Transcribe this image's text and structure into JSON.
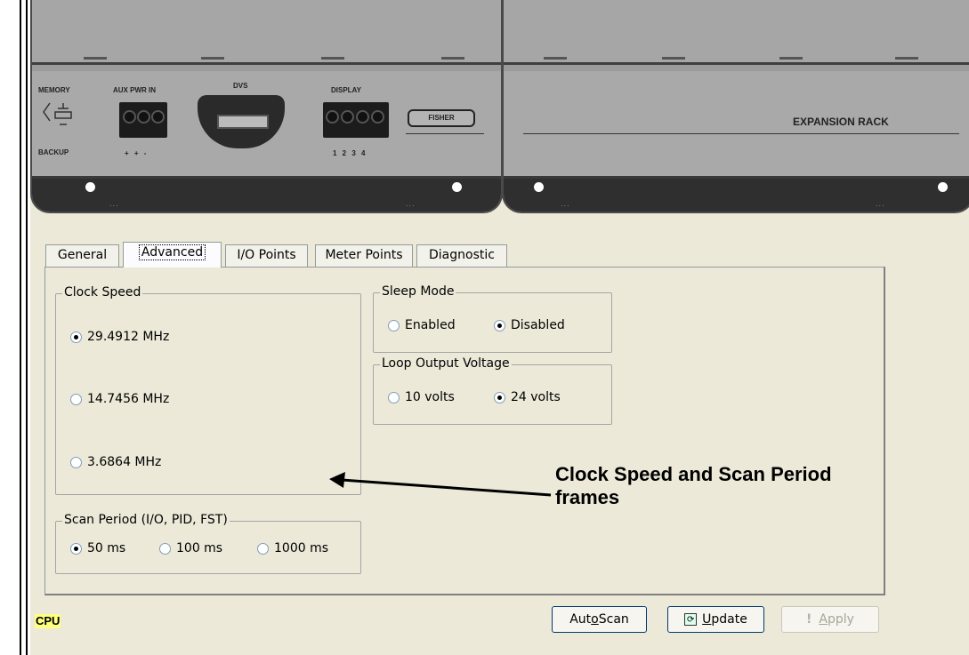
{
  "hardware": {
    "memory_label": "MEMORY",
    "backup_label": "BACKUP",
    "plus_sign": "+",
    "minus_sign": "-",
    "aux_pwr_label": "AUX PWR IN",
    "aux_pins_label": "+ + -",
    "dvs_label": "DVS",
    "display_label": "DISPLAY",
    "display_pins_label": "1 2 3 4",
    "brand_label": "FISHER",
    "expansion_label": "EXPANSION RACK",
    "dots": "..."
  },
  "tabs": [
    {
      "label": "General",
      "active": false
    },
    {
      "label": "Advanced",
      "active": true
    },
    {
      "label": "I/O Points",
      "active": false
    },
    {
      "label": "Meter Points",
      "active": false
    },
    {
      "label": "Diagnostic",
      "active": false
    }
  ],
  "clock_speed": {
    "title": "Clock Speed",
    "options": [
      {
        "label": "29.4912 MHz",
        "selected": true
      },
      {
        "label": "14.7456 MHz",
        "selected": false
      },
      {
        "label": "3.6864 MHz",
        "selected": false
      }
    ]
  },
  "sleep_mode": {
    "title": "Sleep Mode",
    "options": [
      {
        "label": "Enabled",
        "selected": false
      },
      {
        "label": "Disabled",
        "selected": true
      }
    ]
  },
  "loop_output_voltage": {
    "title": "Loop Output Voltage",
    "options": [
      {
        "label": "10 volts",
        "selected": false
      },
      {
        "label": "24 volts",
        "selected": true
      }
    ]
  },
  "scan_period": {
    "title": "Scan Period (I/O, PID, FST)",
    "options": [
      {
        "label": "50 ms",
        "selected": true
      },
      {
        "label": "100 ms",
        "selected": false
      },
      {
        "label": "1000 ms",
        "selected": false
      }
    ]
  },
  "callout": {
    "line1": "Clock Speed and Scan Period",
    "line2": "frames"
  },
  "status": {
    "cpu_label": "CPU"
  },
  "buttons": {
    "auto_scan_pre": "Aut",
    "auto_scan_ul": "o",
    "auto_scan_post": " Scan",
    "update_ul": "U",
    "update_post": "pdate",
    "apply_ul": "A",
    "apply_post": "pply",
    "apply_enabled": false
  },
  "colors": {
    "dialog_bg": "#ece9d8",
    "cpu_highlight": "#ffff80",
    "hardware_gray": "#a9a9a9"
  }
}
